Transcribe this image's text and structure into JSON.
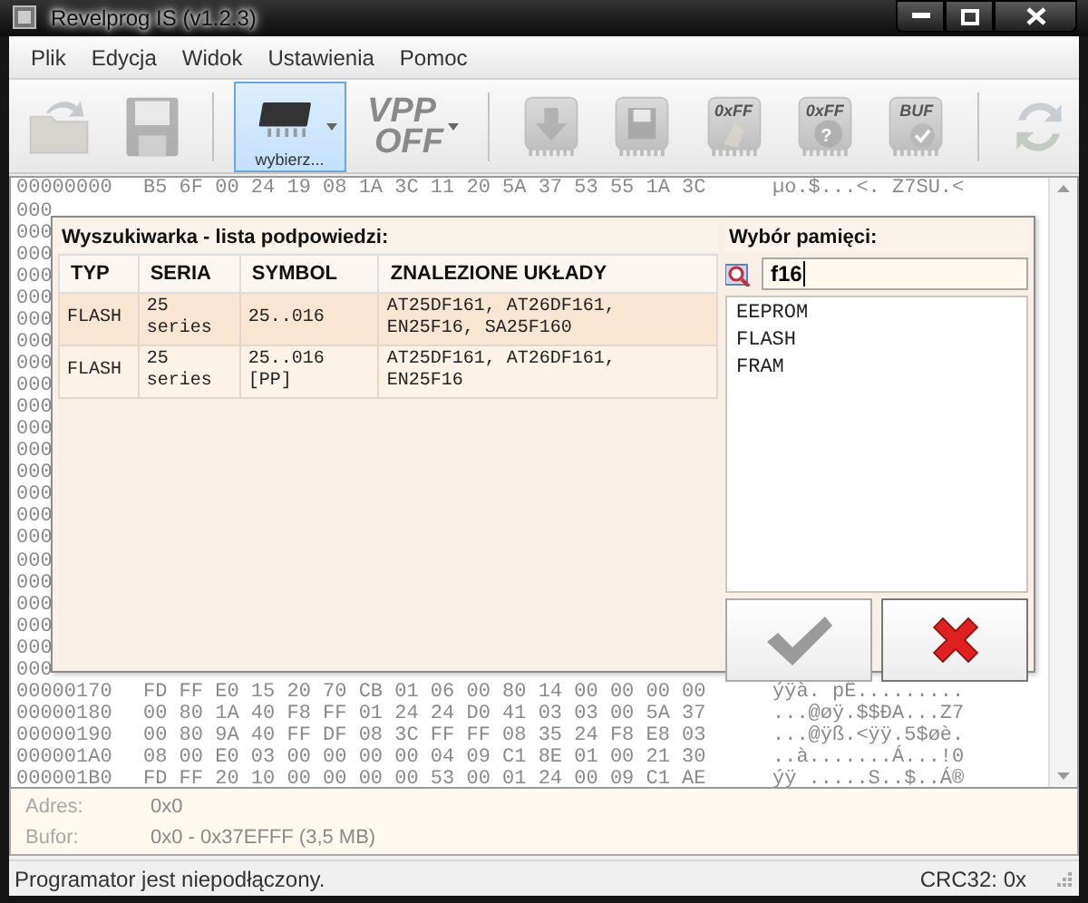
{
  "window": {
    "title": "Revelprog IS (v1.2.3)"
  },
  "menu": [
    "Plik",
    "Edycja",
    "Widok",
    "Ustawienia",
    "Pomoc"
  ],
  "toolbar": [
    {
      "kind": "open",
      "disabled": true,
      "selected": false
    },
    {
      "kind": "save",
      "disabled": true,
      "selected": false
    },
    {
      "kind": "separator"
    },
    {
      "kind": "chip",
      "label": "wybierz...",
      "disabled": false,
      "selected": true
    },
    {
      "kind": "vpp",
      "label_lines": [
        "VPP",
        "OFF"
      ],
      "disabled": true,
      "selected": false
    },
    {
      "kind": "separator"
    },
    {
      "kind": "read",
      "disabled": true,
      "selected": false
    },
    {
      "kind": "write",
      "disabled": true,
      "selected": false
    },
    {
      "kind": "erase",
      "badge": "0xFF",
      "disabled": true,
      "selected": false
    },
    {
      "kind": "blank",
      "badge": "0xFF",
      "sub_badge": "?",
      "disabled": true,
      "selected": false
    },
    {
      "kind": "verify",
      "badge": "BUF",
      "disabled": true,
      "selected": false
    },
    {
      "kind": "separator"
    },
    {
      "kind": "auto",
      "disabled": true,
      "selected": false
    }
  ],
  "hex_view": {
    "rows": [
      {
        "address": "00000000",
        "bytes": "B5 6F 00 24 19 08 1A 3C 11 20 5A 37 53 55 1A 3C",
        "ascii": "µo.$...<. Z7SU.<"
      },
      {
        "address": "000"
      },
      {
        "address": "000"
      },
      {
        "address": "000"
      },
      {
        "address": "000"
      },
      {
        "address": "000"
      },
      {
        "address": "000"
      },
      {
        "address": "000"
      },
      {
        "address": "000"
      },
      {
        "address": "000"
      },
      {
        "address": "000"
      },
      {
        "address": "000"
      },
      {
        "address": "000"
      },
      {
        "address": "000"
      },
      {
        "address": "000"
      },
      {
        "address": "000"
      },
      {
        "address": "000"
      },
      {
        "address": "000"
      },
      {
        "address": "000"
      },
      {
        "address": "000"
      },
      {
        "address": "000"
      },
      {
        "address": "000"
      },
      {
        "address": "000"
      },
      {
        "address": "00000170",
        "bytes": "FD FF E0 15 20 70 CB 01 06 00 80 14 00 00 00 00",
        "ascii": "ýÿà. pË........."
      },
      {
        "address": "00000180",
        "bytes": "00 80 1A 40 F8 FF 01 24 24 D0 41 03 03 00 5A 37",
        "ascii": "...@øÿ.$$ÐA...Z7"
      },
      {
        "address": "00000190",
        "bytes": "00 80 9A 40 FF DF 08 3C FF FF 08 35 24 F8 E8 03",
        "ascii": "...@ÿß.<ÿÿ.5$øè."
      },
      {
        "address": "000001A0",
        "bytes": "08 00 E0 03 00 00 00 00 04 09 C1 8E 01 00 21 30",
        "ascii": "..à.......Á...!0"
      },
      {
        "address": "000001B0",
        "bytes": "FD FF 20 10 00 00 00 00 53 00 01 24 00 09 C1 AE",
        "ascii": "ýÿ .....S..$..Á®"
      }
    ]
  },
  "search_dialog": {
    "results": {
      "title": "Wyszukiwarka - lista podpowiedzi:",
      "columns": [
        "TYP",
        "SERIA",
        "SYMBOL",
        "ZNALEZIONE UKŁADY"
      ],
      "rows": [
        {
          "cells": [
            "FLASH",
            "25\nseries",
            "25..016",
            "AT25DF161, AT26DF161,\nEN25F16, SA25F160"
          ],
          "selected": true
        },
        {
          "cells": [
            "FLASH",
            "25\nseries",
            "25..016\n[PP]",
            "AT25DF161, AT26DF161,\nEN25F16"
          ],
          "selected": false
        }
      ]
    },
    "memory": {
      "title": "Wybór pamięci:",
      "search_value": "f16",
      "items": [
        {
          "label": "EEPROM",
          "selected": false
        },
        {
          "label": "FLASH",
          "selected": false
        },
        {
          "label": "FRAM",
          "selected": false
        }
      ]
    },
    "buttons": [
      {
        "kind": "confirm",
        "disabled": true
      },
      {
        "kind": "cancel",
        "disabled": false
      }
    ]
  },
  "info": [
    {
      "label": "Adres:",
      "value": "0x0"
    },
    {
      "label": "Bufor:",
      "value": "0x0 - 0x37EFFF (3,5 MB)"
    }
  ],
  "status_bar": {
    "message": "Programator jest niepodłączony.",
    "crc": "CRC32: 0x"
  }
}
